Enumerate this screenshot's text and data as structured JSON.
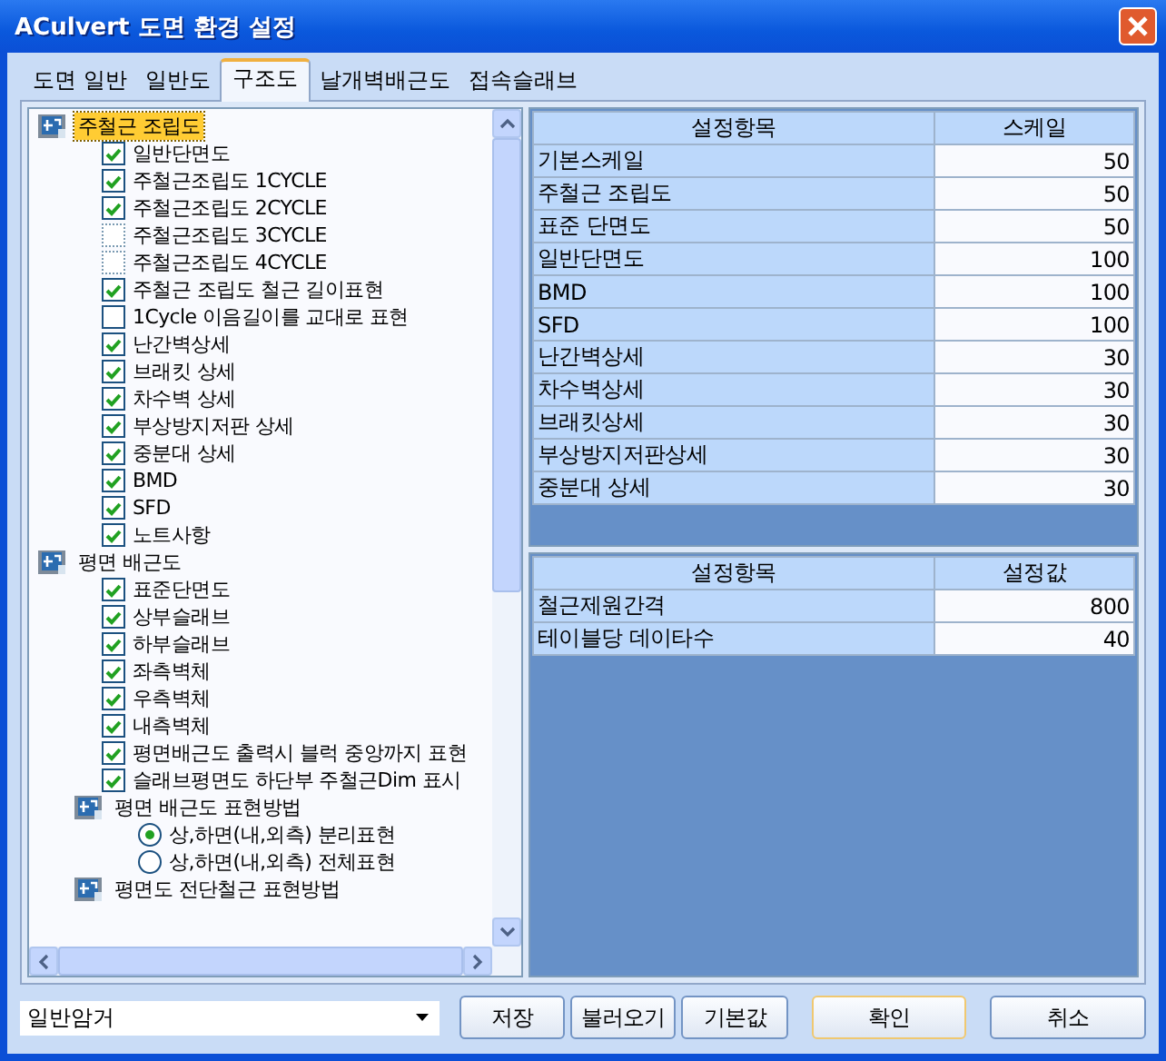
{
  "window": {
    "title": "ACulvert 도면 환경 설정"
  },
  "tabs": [
    {
      "label": "도면 일반",
      "selected": false
    },
    {
      "label": "일반도",
      "selected": false
    },
    {
      "label": "구조도",
      "selected": true
    },
    {
      "label": "날개벽배근도",
      "selected": false
    },
    {
      "label": "접속슬래브",
      "selected": false
    }
  ],
  "tree": [
    {
      "kind": "group",
      "label": "주철근 조립도",
      "selected": true,
      "children": [
        {
          "kind": "check",
          "label": "일반단면도",
          "checked": true,
          "disabled": false
        },
        {
          "kind": "check",
          "label": "주철근조립도 1CYCLE",
          "checked": true,
          "disabled": false
        },
        {
          "kind": "check",
          "label": "주철근조립도 2CYCLE",
          "checked": true,
          "disabled": false
        },
        {
          "kind": "check",
          "label": "주철근조립도 3CYCLE",
          "checked": false,
          "disabled": true
        },
        {
          "kind": "check",
          "label": "주철근조립도 4CYCLE",
          "checked": false,
          "disabled": true
        },
        {
          "kind": "check",
          "label": "주철근 조립도 철근 길이표현",
          "checked": true,
          "disabled": false
        },
        {
          "kind": "check",
          "label": "1Cycle 이음길이를 교대로 표현",
          "checked": false,
          "disabled": false
        },
        {
          "kind": "check",
          "label": "난간벽상세",
          "checked": true,
          "disabled": false
        },
        {
          "kind": "check",
          "label": "브래킷 상세",
          "checked": true,
          "disabled": false
        },
        {
          "kind": "check",
          "label": "차수벽 상세",
          "checked": true,
          "disabled": false
        },
        {
          "kind": "check",
          "label": "부상방지저판 상세",
          "checked": true,
          "disabled": false
        },
        {
          "kind": "check",
          "label": "중분대 상세",
          "checked": true,
          "disabled": false
        },
        {
          "kind": "check",
          "label": "BMD",
          "checked": true,
          "disabled": false
        },
        {
          "kind": "check",
          "label": "SFD",
          "checked": true,
          "disabled": false
        },
        {
          "kind": "check",
          "label": "노트사항",
          "checked": true,
          "disabled": false
        }
      ]
    },
    {
      "kind": "group",
      "label": "평면 배근도",
      "selected": false,
      "children": [
        {
          "kind": "check",
          "label": "표준단면도",
          "checked": true,
          "disabled": false
        },
        {
          "kind": "check",
          "label": "상부슬래브",
          "checked": true,
          "disabled": false
        },
        {
          "kind": "check",
          "label": "하부슬래브",
          "checked": true,
          "disabled": false
        },
        {
          "kind": "check",
          "label": "좌측벽체",
          "checked": true,
          "disabled": false
        },
        {
          "kind": "check",
          "label": "우측벽체",
          "checked": true,
          "disabled": false
        },
        {
          "kind": "check",
          "label": "내측벽체",
          "checked": true,
          "disabled": false
        },
        {
          "kind": "check",
          "label": "평면배근도 출력시 블럭 중앙까지 표현",
          "checked": true,
          "disabled": false
        },
        {
          "kind": "check",
          "label": "슬래브평면도 하단부 주철근Dim 표시",
          "checked": true,
          "disabled": false
        },
        {
          "kind": "group",
          "label": "평면 배근도 표현방법",
          "selected": false,
          "children": [
            {
              "kind": "radio",
              "label": "상,하면(내,외측) 분리표현",
              "selected": true
            },
            {
              "kind": "radio",
              "label": "상,하면(내,외측) 전체표현",
              "selected": false
            }
          ]
        },
        {
          "kind": "group",
          "label": "평면도 전단철근 표현방법",
          "selected": false
        }
      ]
    }
  ],
  "scale_table": {
    "columns": [
      "설정항목",
      "스케일"
    ],
    "rows": [
      [
        "기본스케일",
        "50"
      ],
      [
        "주철근 조립도",
        "50"
      ],
      [
        "표준 단면도",
        "50"
      ],
      [
        "일반단면도",
        "100"
      ],
      [
        "BMD",
        "100"
      ],
      [
        "SFD",
        "100"
      ],
      [
        "난간벽상세",
        "30"
      ],
      [
        "차수벽상세",
        "30"
      ],
      [
        "브래킷상세",
        "30"
      ],
      [
        "부상방지저판상세",
        "30"
      ],
      [
        "중분대 상세",
        "30"
      ]
    ]
  },
  "value_table": {
    "columns": [
      "설정항목",
      "설정값"
    ],
    "rows": [
      [
        "철근제원간격",
        "800"
      ],
      [
        "테이블당 데이타수",
        "40"
      ]
    ]
  },
  "preset": {
    "value": "일반암거"
  },
  "buttons": [
    {
      "label": "저장",
      "kind": "normal"
    },
    {
      "label": "불러오기",
      "kind": "normal"
    },
    {
      "label": "기본값",
      "kind": "normal"
    },
    {
      "label": "확인",
      "kind": "default"
    },
    {
      "label": "취소",
      "kind": "cancel"
    }
  ]
}
